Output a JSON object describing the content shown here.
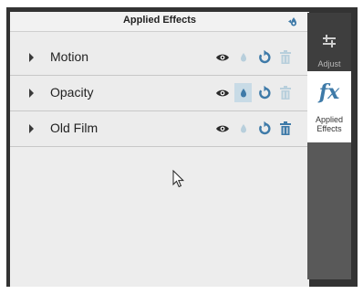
{
  "panel": {
    "title": "Applied Effects",
    "accent_color": "#3e7aa8"
  },
  "effects": [
    {
      "label": "Motion"
    },
    {
      "label": "Opacity",
      "drop_highlighted": true
    },
    {
      "label": "Old Film"
    }
  ],
  "sidebar": {
    "tabs": [
      {
        "label": "Adjust",
        "icon": "sliders-icon",
        "active": false
      },
      {
        "label_line1": "Applied",
        "label_line2": "Effects",
        "icon_text": "fx",
        "icon": "fx-icon",
        "active": true
      }
    ]
  }
}
